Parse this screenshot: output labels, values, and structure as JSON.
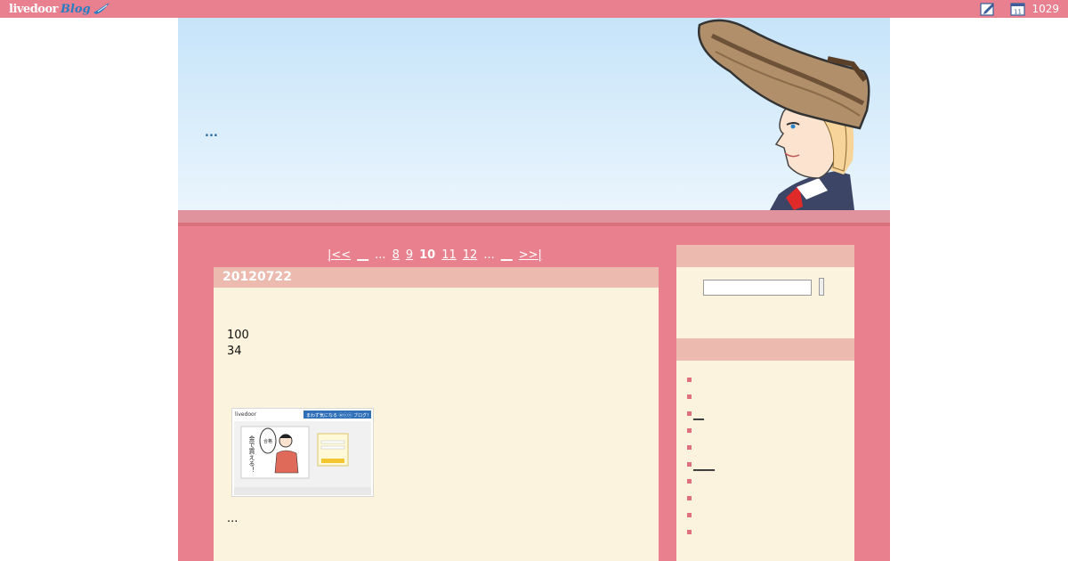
{
  "topbar": {
    "logo_main": "livedoor",
    "logo_blog": "Blog",
    "icons": [
      "edit-icon",
      "calendar-icon"
    ],
    "calendar_day": "11",
    "count": "1029"
  },
  "header": {
    "link_text": "..."
  },
  "pager": {
    "first": "|<<",
    "prev": "__",
    "dots_left": "...",
    "pages": [
      "8",
      "9"
    ],
    "current": "10",
    "pages_after": [
      "11",
      "12"
    ],
    "dots_right": "...",
    "next": "__",
    "last": ">>|"
  },
  "post": {
    "title": "20120722",
    "lines": [
      "100",
      "34"
    ],
    "ellipsis": "..."
  },
  "thumbnail": {
    "brand": "livedoor",
    "banner_text": "まわず気になる ⓦⓒⓢ ブログ！",
    "vertical_text": "金で買える！",
    "character_label": "合格"
  },
  "sidebar": {
    "search_placeholder": "",
    "items": [
      {
        "label": ""
      },
      {
        "label": ""
      },
      {
        "label": "__"
      },
      {
        "label": ""
      },
      {
        "label": ""
      },
      {
        "label": "____"
      },
      {
        "label": ""
      },
      {
        "label": ""
      },
      {
        "label": ""
      },
      {
        "label": ""
      }
    ]
  },
  "colors": {
    "topbar": "#e88090",
    "page_bg": "#e8808e",
    "panel_bg": "#fbf3de",
    "panel_head": "#ecbaae",
    "link_blue": "#2a6aa0"
  }
}
